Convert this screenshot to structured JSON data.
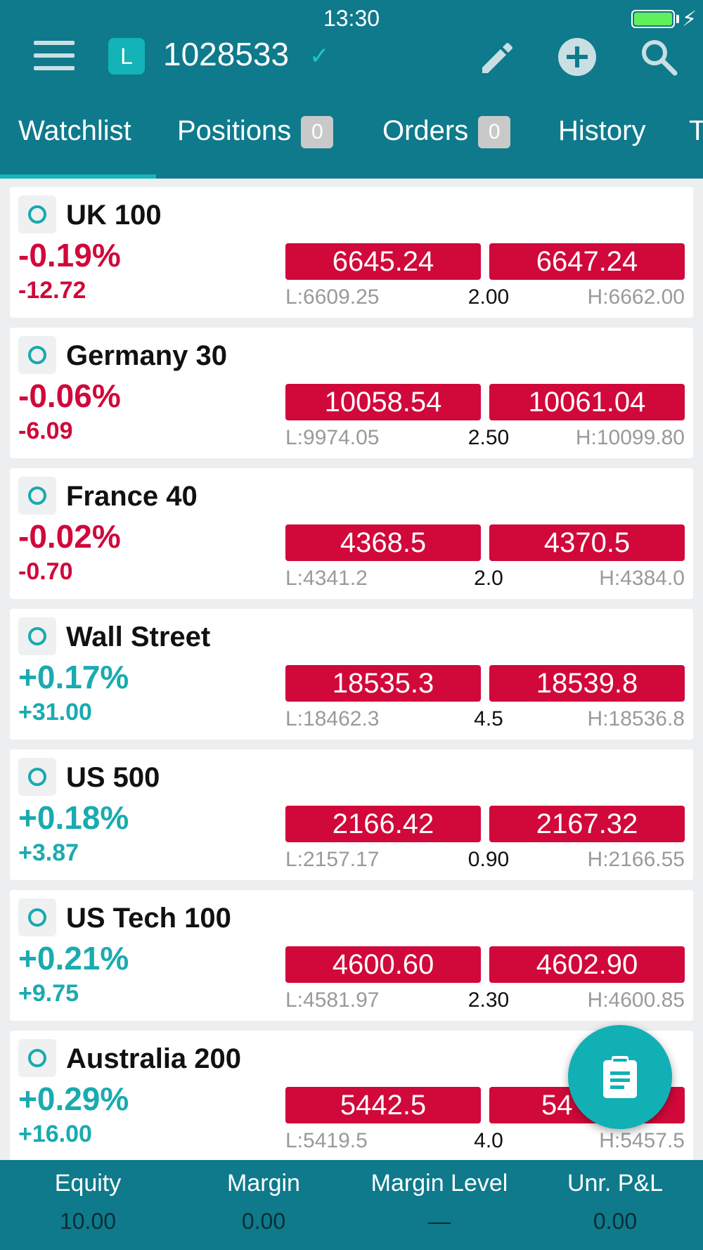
{
  "status_bar": {
    "time": "13:30"
  },
  "header": {
    "account_badge": "L",
    "account_number": "1028533",
    "icons": [
      "menu-icon",
      "check-icon",
      "edit-icon",
      "add-icon",
      "search-icon"
    ]
  },
  "tabs": [
    {
      "label": "Watchlist"
    },
    {
      "label": "Positions",
      "count": "0"
    },
    {
      "label": "Orders",
      "count": "0"
    },
    {
      "label": "History"
    },
    {
      "label": "T"
    }
  ],
  "instruments": [
    {
      "name": "UK 100",
      "pct": "-0.19%",
      "change": "-12.72",
      "direction": "down",
      "sell": "6645.24",
      "buy": "6647.24",
      "low": "L:6609.25",
      "spread": "2.00",
      "high": "H:6662.00"
    },
    {
      "name": "Germany 30",
      "pct": "-0.06%",
      "change": "-6.09",
      "direction": "down",
      "sell": "10058.54",
      "buy": "10061.04",
      "low": "L:9974.05",
      "spread": "2.50",
      "high": "H:10099.80"
    },
    {
      "name": "France 40",
      "pct": "-0.02%",
      "change": "-0.70",
      "direction": "down",
      "sell": "4368.5",
      "buy": "4370.5",
      "low": "L:4341.2",
      "spread": "2.0",
      "high": "H:4384.0"
    },
    {
      "name": "Wall Street",
      "pct": "+0.17%",
      "change": "+31.00",
      "direction": "up",
      "sell": "18535.3",
      "buy": "18539.8",
      "low": "L:18462.3",
      "spread": "4.5",
      "high": "H:18536.8"
    },
    {
      "name": "US 500",
      "pct": "+0.18%",
      "change": "+3.87",
      "direction": "up",
      "sell": "2166.42",
      "buy": "2167.32",
      "low": "L:2157.17",
      "spread": "0.90",
      "high": "H:2166.55"
    },
    {
      "name": "US Tech 100",
      "pct": "+0.21%",
      "change": "+9.75",
      "direction": "up",
      "sell": "4600.60",
      "buy": "4602.90",
      "low": "L:4581.97",
      "spread": "2.30",
      "high": "H:4600.85"
    },
    {
      "name": "Australia 200",
      "pct": "+0.29%",
      "change": "+16.00",
      "direction": "up",
      "sell": "5442.5",
      "buy": "54",
      "low": "L:5419.5",
      "spread": "4.0",
      "high": "H:5457.5"
    }
  ],
  "fab": {
    "icon": "clipboard-icon"
  },
  "footer": [
    {
      "label": "Equity",
      "value": "10.00"
    },
    {
      "label": "Margin",
      "value": "0.00"
    },
    {
      "label": "Margin Level",
      "value": "—"
    },
    {
      "label": "Unr. P&L",
      "value": "0.00"
    }
  ],
  "colors": {
    "header": "#0e7a8b",
    "accent": "#13b3b8",
    "negative": "#d1083a",
    "positive": "#19abb0",
    "price_button": "#d1083a"
  }
}
